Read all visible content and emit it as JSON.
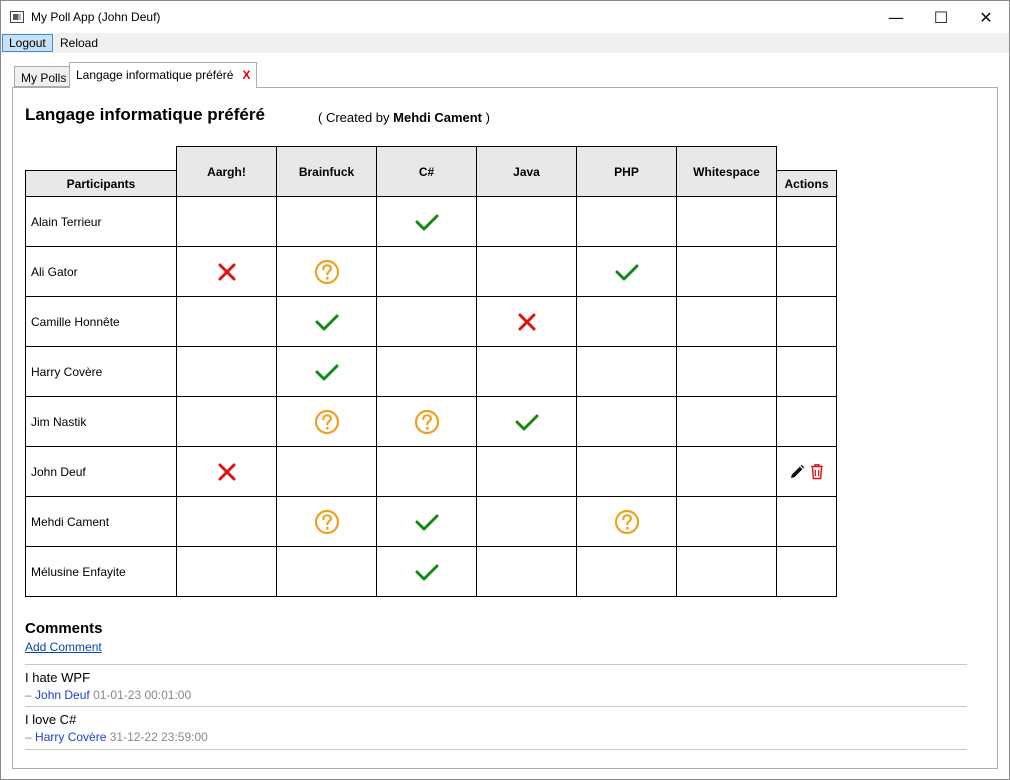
{
  "window": {
    "title": "My Poll App (John Deuf)"
  },
  "window_controls": {
    "minimize": "—",
    "maximize": "☐",
    "close": "✕"
  },
  "menu": {
    "logout": "Logout",
    "reload": "Reload"
  },
  "tabs": [
    {
      "label": "My Polls"
    },
    {
      "label": "Langage informatique préféré",
      "close": "X"
    }
  ],
  "poll": {
    "title": "Langage informatique préféré",
    "created_prefix": "( Created by",
    "creator": "Mehdi Cament",
    "created_suffix": ")"
  },
  "grid": {
    "participants_header": "Participants",
    "actions_header": "Actions",
    "choices": [
      "Aargh!",
      "Brainfuck",
      "C#",
      "Java",
      "PHP",
      "Whitespace"
    ],
    "rows": [
      {
        "name": "Alain Terrieur",
        "votes": [
          "",
          "",
          "yes",
          "",
          "",
          ""
        ],
        "editable": false
      },
      {
        "name": "Ali Gator",
        "votes": [
          "no",
          "maybe",
          "",
          "",
          "yes",
          ""
        ],
        "editable": false
      },
      {
        "name": "Camille Honnête",
        "votes": [
          "",
          "yes",
          "",
          "no",
          "",
          ""
        ],
        "editable": false
      },
      {
        "name": "Harry Covère",
        "votes": [
          "",
          "yes",
          "",
          "",
          "",
          ""
        ],
        "editable": false
      },
      {
        "name": "Jim Nastik",
        "votes": [
          "",
          "maybe",
          "maybe",
          "yes",
          "",
          ""
        ],
        "editable": false
      },
      {
        "name": "John Deuf",
        "votes": [
          "no",
          "",
          "",
          "",
          "",
          ""
        ],
        "editable": true
      },
      {
        "name": "Mehdi Cament",
        "votes": [
          "",
          "maybe",
          "yes",
          "",
          "maybe",
          ""
        ],
        "editable": false
      },
      {
        "name": "Mélusine Enfayite",
        "votes": [
          "",
          "",
          "yes",
          "",
          "",
          ""
        ],
        "editable": false
      }
    ],
    "icons": {
      "yes": "check-icon",
      "no": "cross-icon",
      "maybe": "question-icon",
      "edit": "pencil-icon",
      "delete": "trash-icon"
    },
    "colors": {
      "yes": "#128a12",
      "no": "#e01010",
      "maybe": "#f0a020",
      "delete": "#e01010",
      "header_bg": "#e8e8e8"
    }
  },
  "comments": {
    "title": "Comments",
    "add_link": "Add Comment",
    "items": [
      {
        "text": "I hate WPF",
        "dash": "–",
        "author": "John Deuf",
        "date": "01-01-23 00:01:00"
      },
      {
        "text": "I love C#",
        "dash": "–",
        "author": "Harry Covère",
        "date": "31-12-22 23:59:00"
      }
    ]
  }
}
